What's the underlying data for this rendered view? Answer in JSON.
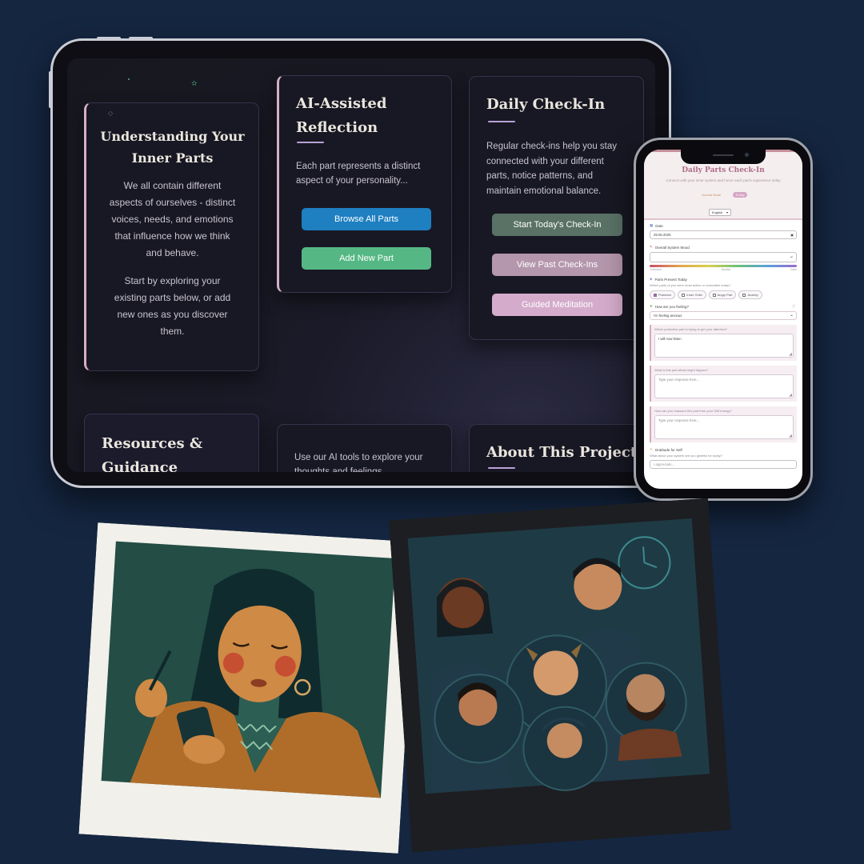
{
  "tablet": {
    "cards": {
      "understanding": {
        "title_line1": "Understanding Your",
        "title_line2": "Inner Parts",
        "para1_lines": [
          "We all contain different",
          "aspects of ourselves - distinct",
          "voices, needs, and emotions",
          "that influence how we think",
          "and behave."
        ],
        "para2_lines": [
          "Start by exploring your",
          "existing parts below, or add",
          "new ones as you discover",
          "them."
        ]
      },
      "ai_reflection": {
        "title_line1": "AI-Assisted",
        "title_line2": "Reflection",
        "text_lines": [
          "Each part represents a distinct",
          "aspect of your personality..."
        ],
        "browse_button": "Browse All Parts",
        "add_button": "Add New Part"
      },
      "daily_checkin": {
        "title": "Daily Check-In",
        "text_lines": [
          "Regular check-ins help you stay",
          "connected with your different",
          "parts, notice patterns, and",
          "maintain emotional balance."
        ],
        "start_button": "Start Today's Check-In",
        "past_button": "View Past Check-Ins",
        "meditation_button": "Guided Meditation"
      },
      "resources": {
        "title_line1": "Resources &",
        "title_line2": "Guidance"
      },
      "ai_tools": {
        "text_line1": "Use our AI tools to explore your",
        "text_line2": "thoughts and feelings..."
      },
      "about": {
        "title": "About This Project"
      }
    }
  },
  "phone": {
    "title": "Daily Parts Check-In",
    "subtitle": "Connect with your inner system and honor each part's experience today",
    "tag": "Journal Mode",
    "badge": "5 Day",
    "language": "English",
    "date_label": "Date",
    "date_value": "29.06.2025",
    "mood_label": "Overall System Mood",
    "mood_low": "Turbulent",
    "mood_mid": "Neutral",
    "mood_high": "Calm",
    "parts_label": "Parts Present Today",
    "parts_help": "Which parts of you were most active or noticeable today?",
    "parts": [
      "Protector",
      "Inner Child",
      "Angry Part",
      "Anxiety"
    ],
    "feeling_label": "How are you feeling?",
    "feeling_value": "I'm feeling anxious",
    "q1": "Which protective part is trying to get your attention?",
    "q1_answer": "I will now listen",
    "q2": "What is this part afraid might happen?",
    "q2_placeholder": "Type your response here...",
    "q3": "How can you reassure this part from your Self energy?",
    "q3_placeholder": "Type your response here...",
    "gratitude_label": "Gratitude for Self",
    "gratitude_help": "What about your system are you grateful for today?",
    "gratitude_placeholder": "I appreciate..."
  },
  "colors": {
    "background": "#152641",
    "browse_button": "#1e7fc1",
    "add_button": "#55b884",
    "start_button": "#5a7266",
    "past_button": "#b597ad",
    "meditation_button": "#d4abcb"
  }
}
